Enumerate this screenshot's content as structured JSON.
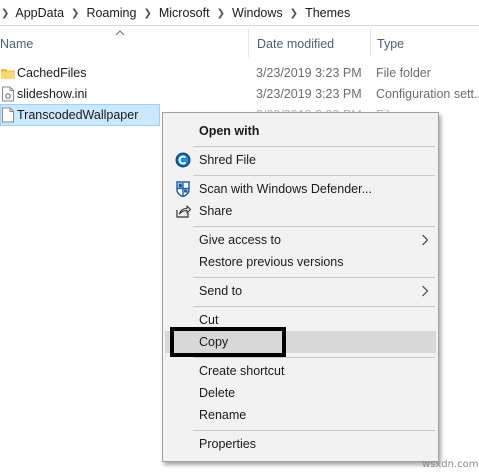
{
  "breadcrumb": {
    "items": [
      "AppData",
      "Roaming",
      "Microsoft",
      "Windows",
      "Themes"
    ]
  },
  "columns": {
    "name": "Name",
    "date_modified": "Date modified",
    "type": "Type"
  },
  "files": [
    {
      "name": "CachedFiles",
      "date": "3/23/2019 3:23 PM",
      "type": "File folder",
      "icon": "folder-icon"
    },
    {
      "name": "slideshow.ini",
      "date": "3/23/2019 3:23 PM",
      "type": "Configuration sett...",
      "icon": "settings-file-icon"
    },
    {
      "name": "TranscodedWallpaper",
      "date": "3/23/2019 3:23 PM",
      "type": "File",
      "icon": "file-icon"
    }
  ],
  "context_menu": {
    "open_with": "Open with",
    "shred_file": "Shred File",
    "scan_defender": "Scan with Windows Defender...",
    "share": "Share",
    "give_access": "Give access to",
    "restore_versions": "Restore previous versions",
    "send_to": "Send to",
    "cut": "Cut",
    "copy": "Copy",
    "create_shortcut": "Create shortcut",
    "delete": "Delete",
    "rename": "Rename",
    "properties": "Properties"
  },
  "colors": {
    "selection": "#cce8ff",
    "menu_background": "#f2f2f2",
    "hover": "#d8d8d8",
    "header_text": "#4c607a"
  },
  "watermark": "wsxdn.com"
}
